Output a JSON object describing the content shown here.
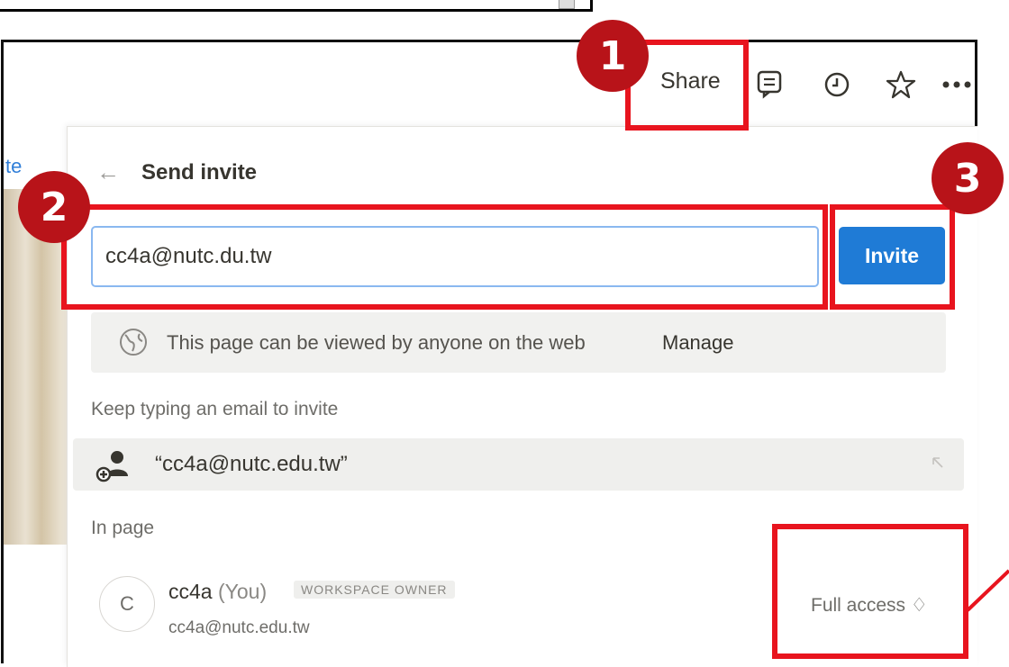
{
  "topbar": {
    "share_label": "Share",
    "icons": [
      "comment-icon",
      "history-clock-icon",
      "star-icon",
      "more-dots-icon"
    ]
  },
  "sidebar_link": "te",
  "panel": {
    "back_icon": "back-arrow-icon",
    "title": "Send invite",
    "email_value": "cc4a@nutc.du.tw",
    "invite_label": "Invite",
    "notice_text": "This page can be viewed by anyone on the web",
    "notice_action": "Manage",
    "hint": "Keep typing an email to invite",
    "suggestion": "“cc4a@nutc.edu.tw”",
    "section_label": "In page",
    "member": {
      "initial": "C",
      "name": "cc4a",
      "you_tag": "(You)",
      "role": "WORKSPACE OWNER",
      "email": "cc4a@nutc.edu.tw",
      "access": "Full access ♢"
    }
  },
  "annotations": {
    "badge_1": "1",
    "badge_2": "2",
    "badge_3": "3",
    "highlight_color": "#e8141e",
    "badge_color": "#b81319"
  },
  "colors": {
    "accent": "#1f7bd6",
    "input_border": "#8ab8f0"
  }
}
